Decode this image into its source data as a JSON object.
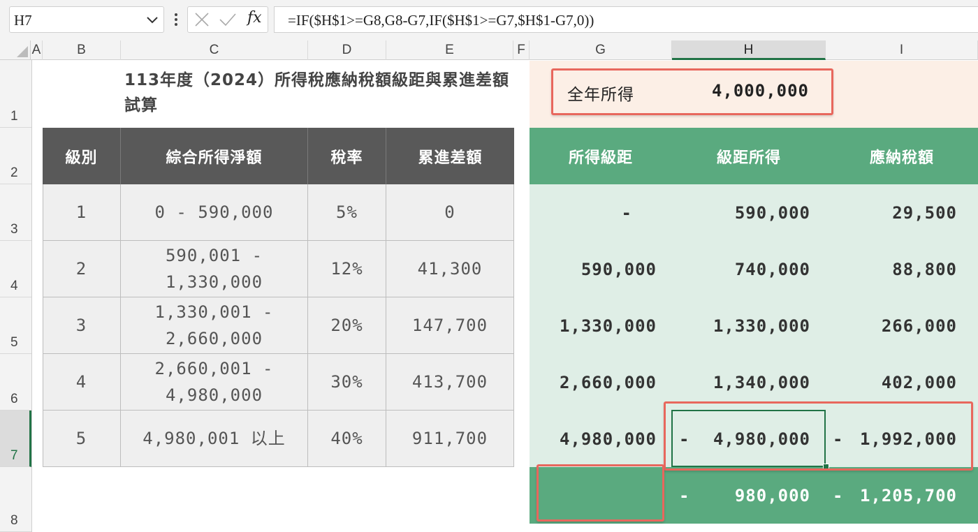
{
  "formula_bar": {
    "name_box": "H7",
    "fx_label": "fx",
    "formula": "=IF($H$1>=G8,G8-G7,IF($H$1>=G7,$H$1-G7,0))"
  },
  "columns": [
    "A",
    "B",
    "C",
    "D",
    "E",
    "F",
    "G",
    "H",
    "I"
  ],
  "selected_column": "H",
  "rows": [
    "1",
    "2",
    "3",
    "4",
    "5",
    "6",
    "7",
    "8"
  ],
  "selected_row": "7",
  "title": "113年度（2024）所得稅應納稅額級距與累進差額試算",
  "left_table": {
    "headers": [
      "級別",
      "綜合所得淨額",
      "稅率",
      "累進差額"
    ],
    "rows": [
      [
        "1",
        "0 - 590,000",
        "5%",
        "0"
      ],
      [
        "2",
        "590,001 - 1,330,000",
        "12%",
        "41,300"
      ],
      [
        "3",
        "1,330,001 - 2,660,000",
        "20%",
        "147,700"
      ],
      [
        "4",
        "2,660,001 - 4,980,000",
        "30%",
        "413,700"
      ],
      [
        "5",
        "4,980,001 以上",
        "40%",
        "911,700"
      ]
    ]
  },
  "annual_income": {
    "label": "全年所得",
    "value": "4,000,000"
  },
  "right_table": {
    "headers": [
      "所得級距",
      "級距所得",
      "應納稅額"
    ],
    "rows": [
      {
        "g": "-",
        "h": "590,000",
        "h_neg": "",
        "i": "29,500",
        "i_neg": ""
      },
      {
        "g": "590,000",
        "h": "740,000",
        "h_neg": "",
        "i": "88,800",
        "i_neg": ""
      },
      {
        "g": "1,330,000",
        "h": "1,330,000",
        "h_neg": "",
        "i": "266,000",
        "i_neg": ""
      },
      {
        "g": "2,660,000",
        "h": "1,340,000",
        "h_neg": "",
        "i": "402,000",
        "i_neg": ""
      },
      {
        "g": "4,980,000",
        "h": "4,980,000",
        "h_neg": "-",
        "i": "1,992,000",
        "i_neg": "-"
      }
    ],
    "total": {
      "g": "",
      "h": "980,000",
      "h_neg": "-",
      "i": "1,205,700",
      "i_neg": "-"
    }
  },
  "colors": {
    "accent_green": "#5aaa7f",
    "light_green": "#dfeee6",
    "header_dark": "#595959",
    "highlight_red": "#e8675d",
    "peach": "#fcefe6"
  }
}
